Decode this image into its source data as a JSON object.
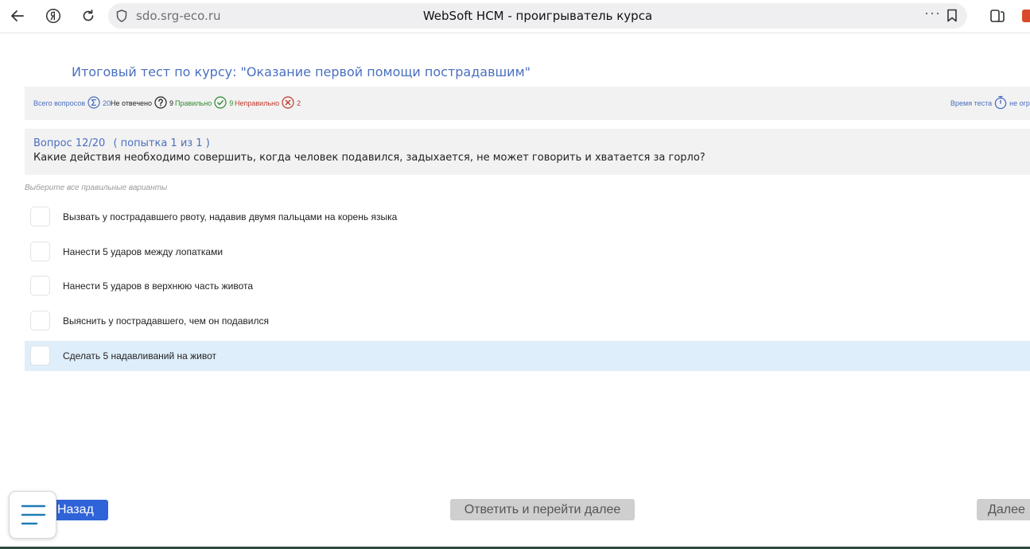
{
  "browser": {
    "url": "sdo.srg-eco.ru",
    "tab_title": "WebSoft HCM - проигрыватель курса",
    "more_glyph": "···"
  },
  "test": {
    "title": "Итоговый тест по курсу: \"Оказание первой помощи пострадавшим\""
  },
  "stats": {
    "total": {
      "label": "Всего вопросов",
      "value": "20",
      "color": "#4a6fc0"
    },
    "unanswered": {
      "label": "Не отвечено",
      "value": "9",
      "color": "#222222"
    },
    "correct": {
      "label": "Правильно",
      "value": "9",
      "color": "#2e8b2e"
    },
    "incorrect": {
      "label": "Неправильно",
      "value": "2",
      "color": "#c0392b"
    },
    "time": {
      "label": "Время теста",
      "value": "не огра"
    }
  },
  "question": {
    "number": "Вопрос 12/20",
    "attempt": "( попытка  1 из 1 )",
    "text": "Какие действия необходимо совершить, когда человек подавился, задыхается, не может говорить и хватается за горло?",
    "hint": "Выберите все правильные варианты"
  },
  "options": [
    {
      "text": "Вызвать у пострадавшего рвоту, надавив двумя пальцами на корень языка"
    },
    {
      "text": "Нанести 5 ударов между лопатками"
    },
    {
      "text": "Нанести 5 ударов в верхнюю часть живота"
    },
    {
      "text": "Выяснить у пострадавшего, чем он подавился"
    },
    {
      "text": "Сделать 5 надавливаний на живот"
    }
  ],
  "footer": {
    "back_label": "Назад",
    "answer_label": "Ответить и перейти далее",
    "next_label": "Далее"
  },
  "colors": {
    "accent": "#2f63d8",
    "title_blue": "#4a6fc0",
    "selected_row": "#dfeefb"
  }
}
